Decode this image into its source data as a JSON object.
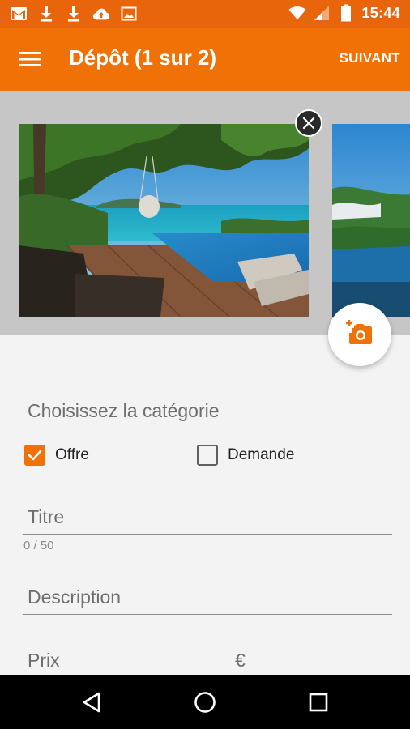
{
  "status_bar": {
    "time": "15:44",
    "icons": [
      "gmail-icon",
      "download-icon",
      "download-icon",
      "cloud-upload-icon",
      "image-icon",
      "wifi-icon",
      "signal-icon",
      "battery-icon"
    ]
  },
  "toolbar": {
    "menu_icon": "hamburger-menu-icon",
    "title": "Dépôt (1 sur 2)",
    "next_label": "SUIVANT"
  },
  "gallery": {
    "remove_icon": "close-icon",
    "add_photo_icon": "add-photo-icon"
  },
  "form": {
    "category_placeholder": "Choisissez la catégorie",
    "offer_label": "Offre",
    "offer_checked": true,
    "request_label": "Demande",
    "request_checked": false,
    "title_placeholder": "Titre",
    "title_counter": "0 / 50",
    "description_placeholder": "Description",
    "price_placeholder": "Prix",
    "currency": "€"
  },
  "nav": {
    "back_icon": "back-triangle-icon",
    "home_icon": "home-circle-icon",
    "recents_icon": "recents-square-icon"
  },
  "colors": {
    "status_bar": "#e9650c",
    "toolbar": "#f07105",
    "accent": "#f07105",
    "gallery_bg": "#c6c6c6",
    "page_bg": "#f3f3f3"
  }
}
